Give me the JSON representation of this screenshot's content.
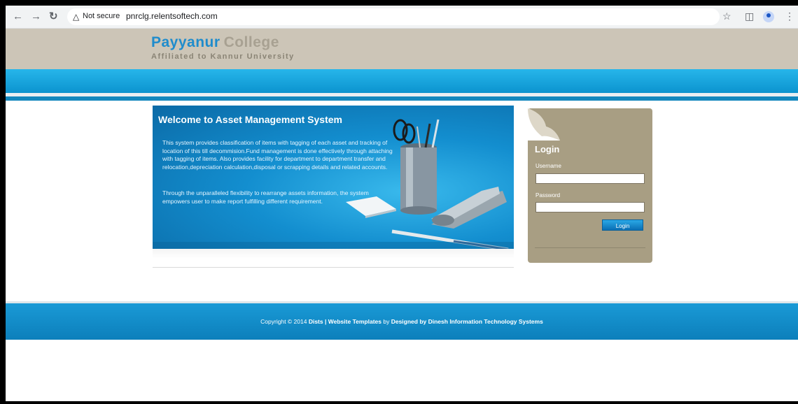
{
  "browser": {
    "back_icon": "arrow-left-icon",
    "forward_icon": "arrow-right-icon",
    "reload_icon": "reload-icon",
    "security_label": "Not secure",
    "url": "pnrclg.relentsoftech.com"
  },
  "site": {
    "brand_primary": "Payyanur",
    "brand_secondary": "College",
    "tagline": "Affiliated to Kannur University"
  },
  "welcome": {
    "title": "Welcome to Asset Management System",
    "paragraph1": "This system provides classification of items with tagging of each asset and tracking of location of this till decommision.Fund management is done effectively through attaching with tagging of items. Also provides facility for department to department transfer and relocation,depreciation calculation,disposal or scrapping details and related accounts.",
    "paragraph2": "Through the unparalleled flexibility to rearrange assets information, the system empowers user to make report fulfilling different requirement."
  },
  "login": {
    "title": "Login",
    "username_label": "Username",
    "username_value": "",
    "password_label": "Password",
    "password_value": "",
    "button_label": "Login"
  },
  "footer": {
    "copyright": "Copyright © 2014",
    "link1": "Dists",
    "separator": "|",
    "link2": "Website Templates",
    "by": "by",
    "designer": "Designed by Dinesh Information Technology Systems"
  },
  "colors": {
    "header_bg": "#ccc5b7",
    "brand_blue": "#1f8ccc",
    "band_blue": "#0b93cf",
    "panel_bg": "#a89e83"
  }
}
